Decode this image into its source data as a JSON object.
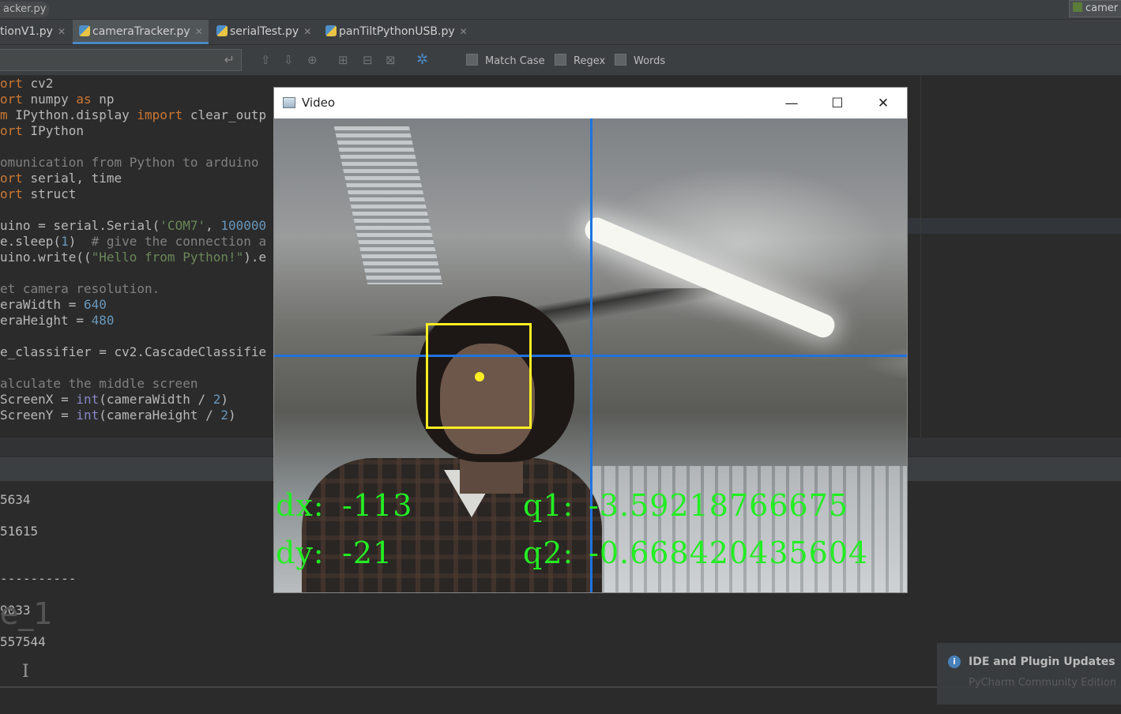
{
  "topbar": {
    "file": "acker.py",
    "run_config": "camer"
  },
  "tabs": [
    {
      "label": "tionV1.py",
      "active": false
    },
    {
      "label": "cameraTracker.py",
      "active": true
    },
    {
      "label": "serialTest.py",
      "active": false
    },
    {
      "label": "panTiltPythonUSB.py",
      "active": false
    }
  ],
  "find": {
    "enter_icon": "↵",
    "options": [
      "Match Case",
      "Regex",
      "Words"
    ]
  },
  "code_lines": [
    [
      [
        "kw",
        "ort"
      ],
      [
        "t",
        " cv2"
      ]
    ],
    [
      [
        "kw",
        "ort"
      ],
      [
        "t",
        " numpy "
      ],
      [
        "kw",
        "as"
      ],
      [
        "t",
        " np"
      ]
    ],
    [
      [
        "kw",
        "m"
      ],
      [
        "t",
        " IPython.display "
      ],
      [
        "kw",
        "import"
      ],
      [
        "t",
        " clear_outp"
      ]
    ],
    [
      [
        "kw",
        "ort"
      ],
      [
        "t",
        " IPython"
      ]
    ],
    [],
    [
      [
        "cm",
        "omunication from Python to arduino"
      ]
    ],
    [
      [
        "kw",
        "ort"
      ],
      [
        "t",
        " serial, time"
      ]
    ],
    [
      [
        "kw",
        "ort"
      ],
      [
        "t",
        " struct"
      ]
    ],
    [],
    [
      [
        "t",
        "uino = serial.Serial("
      ],
      [
        "st",
        "'COM7'"
      ],
      [
        "t",
        ", "
      ],
      [
        "nm",
        "100000"
      ]
    ],
    [
      [
        "t",
        "e.sleep("
      ],
      [
        "nm",
        "1"
      ],
      [
        "t",
        ")  "
      ],
      [
        "cm",
        "# give the connection a"
      ]
    ],
    [
      [
        "t",
        "uino.write(("
      ],
      [
        "st",
        "\"Hello from Python!\""
      ],
      [
        "t",
        ").e"
      ]
    ],
    [],
    [
      [
        "cm",
        "et camera resolution."
      ]
    ],
    [
      [
        "t",
        "eraWidth = "
      ],
      [
        "nm",
        "640"
      ]
    ],
    [
      [
        "t",
        "eraHeight = "
      ],
      [
        "nm",
        "480"
      ]
    ],
    [],
    [
      [
        "t",
        "e_classifier = cv2.CascadeClassifie"
      ]
    ],
    [],
    [
      [
        "cm",
        "alculate the middle screen"
      ]
    ],
    [
      [
        "t",
        "ScreenX = "
      ],
      [
        "bi",
        "int"
      ],
      [
        "t",
        "(cameraWidth / "
      ],
      [
        "nm",
        "2"
      ],
      [
        "t",
        ")"
      ]
    ],
    [
      [
        "t",
        "ScreenY = "
      ],
      [
        "bi",
        "int"
      ],
      [
        "t",
        "(cameraHeight / "
      ],
      [
        "nm",
        "2"
      ],
      [
        "t",
        ")"
      ]
    ]
  ],
  "console": {
    "lines": [
      "5634",
      "51615",
      "----------",
      "9033",
      "557544",
      "---------"
    ],
    "big_text": "e_1"
  },
  "notification": {
    "title": "IDE and Plugin Updates",
    "body": "PyCharm Community Edition"
  },
  "video": {
    "title": "Video",
    "controls": {
      "minimize": "—",
      "maximize": "☐",
      "close": "✕"
    },
    "dx_label": "dx:",
    "dx": "-113",
    "dy_label": "dy:",
    "dy": "-21",
    "q1_label": "q1:",
    "q1": "-3.59218766675",
    "q2_label": "q2:",
    "q2": "-0.668420435604",
    "crosshair_color": "#1f73e0",
    "box_color": "#ffee22",
    "text_color": "#22ee22"
  }
}
